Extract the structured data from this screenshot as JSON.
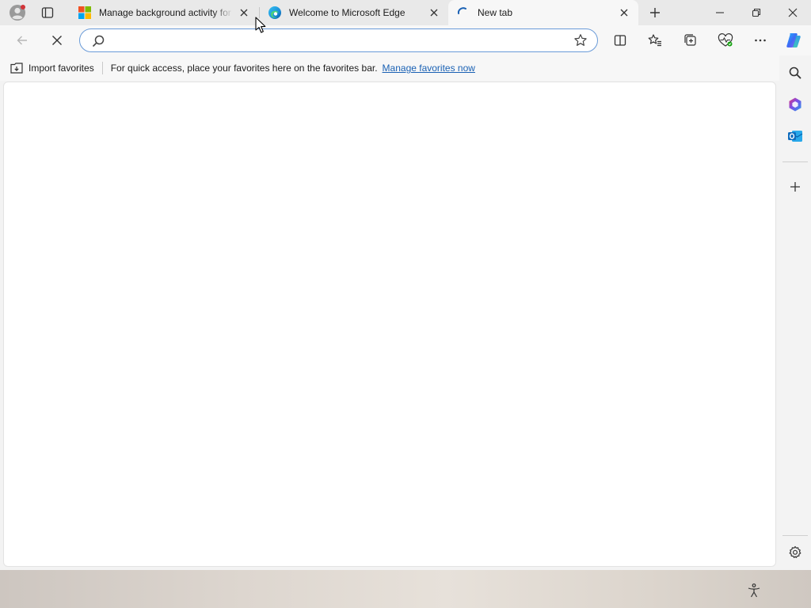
{
  "tabs": [
    {
      "title": "Manage background activity for",
      "favicon": "microsoft-logo-icon",
      "state": "inactive"
    },
    {
      "title": "Welcome to Microsoft Edge",
      "favicon": "edge-logo-icon",
      "state": "inactive"
    },
    {
      "title": "New tab",
      "favicon": "loading-spinner-icon",
      "state": "active"
    }
  ],
  "address_bar": {
    "value": "",
    "placeholder": ""
  },
  "favorites_bar": {
    "import_label": "Import favorites",
    "message": "For quick access, place your favorites here on the favorites bar.",
    "link": "Manage favorites now"
  },
  "colors": {
    "accent": "#1a61b4",
    "omnibox_border": "#6a9bd8",
    "profile_badge": "#d13438"
  },
  "toolbar_icons": [
    "back-icon",
    "stop-loading-icon",
    "split-screen-icon",
    "favorites-icon",
    "collections-icon",
    "browser-essentials-icon",
    "more-options-icon",
    "copilot-icon"
  ],
  "sidebar_icons": [
    "search-icon",
    "microsoft-365-icon",
    "outlook-icon",
    "add-icon",
    "settings-icon"
  ]
}
